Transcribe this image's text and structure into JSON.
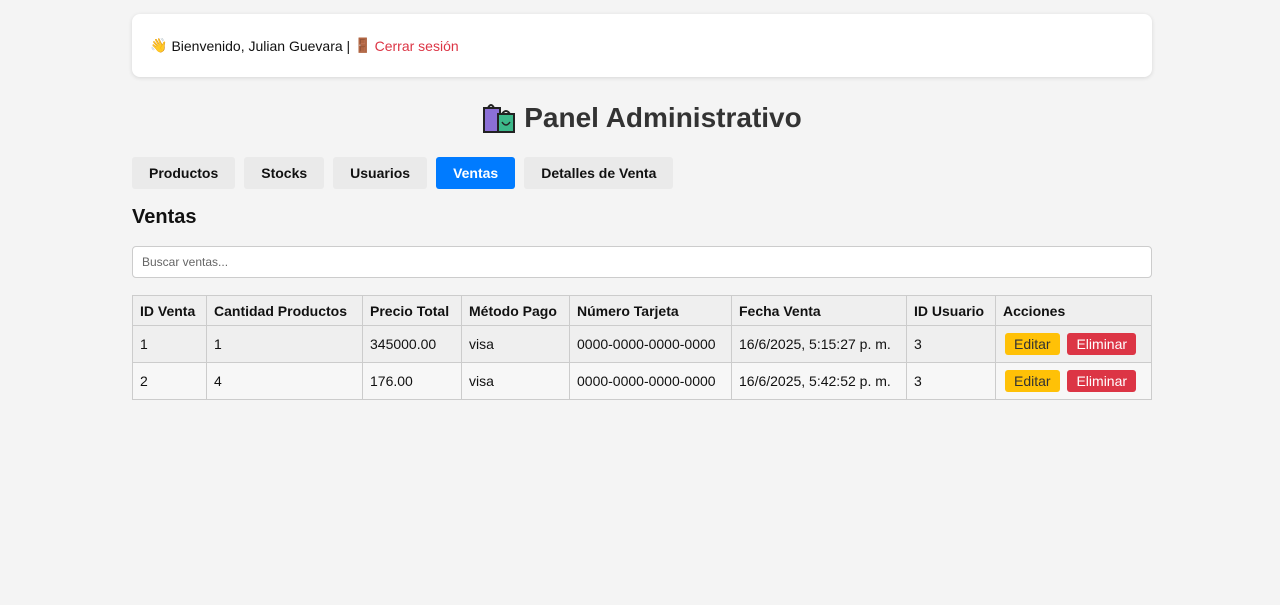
{
  "header": {
    "wave_emoji": "👋",
    "welcome_text": "Bienvenido, Julian Guevara |",
    "door_emoji": "🚪",
    "logout_label": "Cerrar sesión"
  },
  "page": {
    "title_emoji": "🛍️",
    "title": "Panel Administrativo"
  },
  "tabs": [
    {
      "label": "Productos",
      "active": false
    },
    {
      "label": "Stocks",
      "active": false
    },
    {
      "label": "Usuarios",
      "active": false
    },
    {
      "label": "Ventas",
      "active": true
    },
    {
      "label": "Detalles de Venta",
      "active": false
    }
  ],
  "section": {
    "title": "Ventas",
    "search_placeholder": "Buscar ventas..."
  },
  "table": {
    "headers": [
      "ID Venta",
      "Cantidad Productos",
      "Precio Total",
      "Método Pago",
      "Número Tarjeta",
      "Fecha Venta",
      "ID Usuario",
      "Acciones"
    ],
    "rows": [
      [
        "1",
        "1",
        "345000.00",
        "visa",
        "0000-0000-0000-0000",
        "16/6/2025, 5:15:27 p. m.",
        "3"
      ],
      [
        "2",
        "4",
        "176.00",
        "visa",
        "0000-0000-0000-0000",
        "16/6/2025, 5:42:52 p. m.",
        "3"
      ]
    ],
    "edit_label": "Editar",
    "delete_label": "Eliminar"
  },
  "colors": {
    "accent": "#007bff",
    "danger": "#dc3545",
    "warning": "#ffc107",
    "background": "#f4f4f4"
  }
}
